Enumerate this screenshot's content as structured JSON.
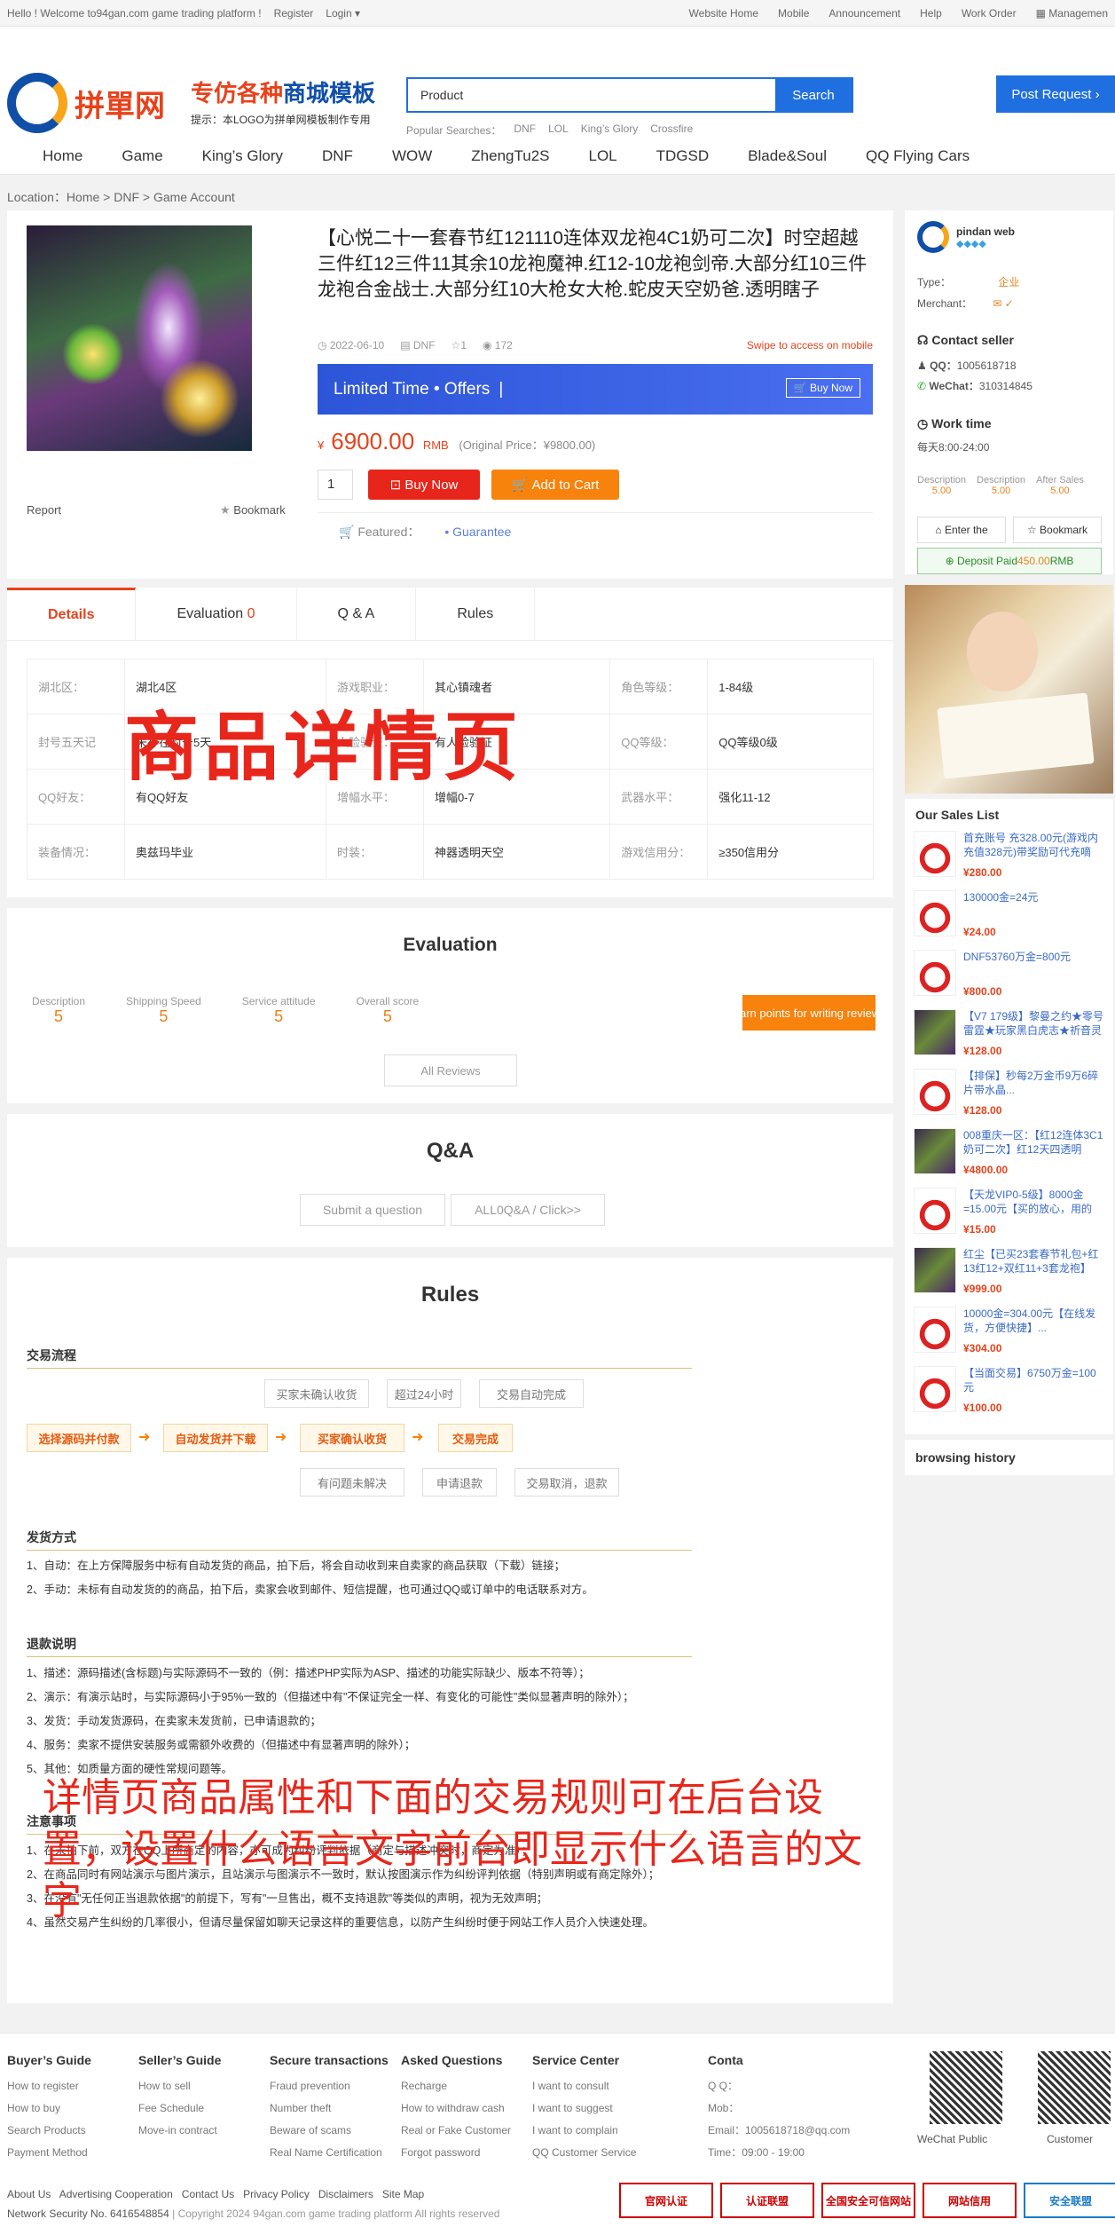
{
  "topbar": {
    "welcome": "Hello ! Welcome to94gan.com game trading platform !",
    "register": "Register",
    "login": "Login ▾",
    "links": [
      "Website Home",
      "Mobile",
      "Announcement",
      "Help",
      "Work Order"
    ],
    "management": "Managemen"
  },
  "header": {
    "logo_text": "拼單网",
    "slogan_line1_a": "专仿各种",
    "slogan_line1_b": "商城模板",
    "slogan_line2": "提示：本LOGO为拼单网模板制作专用",
    "search_value": "Product",
    "search_button": "Search",
    "popular_label": "Popular Searches：",
    "popular": [
      "DNF",
      "LOL",
      "King’s Glory",
      "Crossfire"
    ],
    "post_request": "Post Request ›"
  },
  "nav": [
    "Home",
    "Game",
    "King’s Glory",
    "DNF",
    "WOW",
    "ZhengTu2S",
    "LOL",
    "TDGSD",
    "Blade&Soul",
    "QQ Flying Cars"
  ],
  "breadcrumb": "Location：Home > DNF > Game Account",
  "product": {
    "title": "【心悦二十一套春节红121110连体双龙袍4C1奶可二次】时空超越三件红12三件11其余10龙袍魔神.红12-10龙袍剑帝.大部分红10三件龙袍合金战士.大部分红10大枪女大枪.蛇皮天空奶爸.透明瞎子",
    "date": "2022-06-10",
    "game": "DNF",
    "likes": "1",
    "views": "172",
    "swipe": "Swipe to access on mobile",
    "promo": "Limited Time • Offers",
    "promo_btn": "Buy Now",
    "currency": "¥",
    "price": "6900.00",
    "price_unit": "RMB",
    "original": "(Original Price：¥9800.00)",
    "qty": "1",
    "buy_now": "Buy Now",
    "add_cart": "Add to Cart",
    "featured": "Featured：",
    "guarantee": "• Guarantee",
    "report": "Report",
    "bookmark": "Bookmark"
  },
  "tabs": {
    "details": "Details",
    "evaluation": "Evaluation",
    "evaluation_count": "0",
    "qa": "Q & A",
    "rules": "Rules"
  },
  "attributes": [
    [
      "湖北区：",
      "湖北4区",
      "游戏职业：",
      "其心镇魂者",
      "角色等级：",
      "1-84级"
    ],
    [
      "封号五天记",
      "未存在封号5天",
      "人脸验证：",
      "有人脸验证",
      "QQ等级：",
      "QQ等级0级"
    ],
    [
      "QQ好友：",
      "有QQ好友",
      "增幅水平：",
      "增幅0-7",
      "武器水平：",
      "强化11-12"
    ],
    [
      "装备情况：",
      "奥兹玛毕业",
      "时装：",
      "神器透明天空",
      "游戏信用分：",
      "≥350信用分"
    ]
  ],
  "overlay1": "商品详情页",
  "evaluation": {
    "title": "Evaluation",
    "scores": [
      [
        "Description",
        "5"
      ],
      [
        "Shipping Speed",
        "5"
      ],
      [
        "Service attitude",
        "5"
      ],
      [
        "Overall score",
        "5"
      ]
    ],
    "earn": "Earn points for writing reviews",
    "all_reviews": "All Reviews"
  },
  "qa": {
    "title": "Q&A",
    "submit": "Submit a question",
    "all": "ALL0Q&A / Click>>"
  },
  "rules": {
    "title": "Rules",
    "flow_title": "交易流程",
    "flow_main": [
      "选择源码并付款",
      "自动发货并下载",
      "买家确认收货",
      "交易完成"
    ],
    "flow_top": [
      "买家未确认收货",
      "超过24小时",
      "交易自动完成"
    ],
    "flow_bottom": [
      "有问题未解决",
      "申请退款",
      "交易取消，退款"
    ],
    "ship_title": "发货方式",
    "ship": [
      "1、自动：在上方保障服务中标有自动发货的商品，拍下后，将会自动收到来自卖家的商品获取（下载）链接；",
      "2、手动：未标有自动发货的的商品，拍下后，卖家会收到邮件、短信提醒，也可通过QQ或订单中的电话联系对方。"
    ],
    "refund_title": "退款说明",
    "refund": [
      "1、描述：源码描述(含标题)与实际源码不一致的（例：描述PHP实际为ASP、描述的功能实际缺少、版本不符等）；",
      "2、演示：有演示站时，与实际源码小于95%一致的（但描述中有\"不保证完全一样、有变化的可能性\"类似显著声明的除外）；",
      "3、发货：手动发货源码，在卖家未发货前，已申请退款的；",
      "4、服务：卖家不提供安装服务或需额外收费的（但描述中有显著声明的除外）；",
      "5、其他：如质量方面的硬性常规问题等。"
    ],
    "note_title": "注意事项",
    "notes": [
      "1、在未拍下前，双方在QQ上所商定的内容，亦可成为纠纷评判依据（商定与描述冲突时，商定为准）；",
      "2、在商品同时有网站演示与图片演示，且站演示与图演示不一致时，默认按图演示作为纠纷评判依据（特别声明或有商定除外）；",
      "3、在没有\"无任何正当退款依据\"的前提下，写有\"一旦售出，概不支持退款\"等类似的声明，视为无效声明；",
      "4、虽然交易产生纠纷的几率很小，但请尽量保留如聊天记录这样的重要信息，以防产生纠纷时便于网站工作人员介入快速处理。"
    ]
  },
  "overlay2": "详情页商品属性和下面的交易规则可在后台设置，设置什么语言文字前台即显示什么语言的文字",
  "seller": {
    "name": "pindan web",
    "type_label": "Type：",
    "type_value": "企业",
    "merchant_label": "Merchant：",
    "contact_title": "Contact seller",
    "qq_label": "QQ：",
    "qq": "1005618718",
    "wechat_label": "WeChat：",
    "wechat": "310314845",
    "work_title": "Work time",
    "work_time": "每天8:00-24:00",
    "ratings": [
      [
        "Description",
        "5.00"
      ],
      [
        "Description",
        "5.00"
      ],
      [
        "After Sales",
        "5.00"
      ]
    ],
    "enter": "Enter the",
    "bookmark": "Bookmark",
    "deposit_label": "Deposit Paid",
    "deposit": "450.00",
    "deposit_unit": "RMB"
  },
  "sales": {
    "title": "Our Sales List",
    "items": [
      [
        "首充账号 充328.00元(游戏内充值328元)带奖励可代充嘀",
        "¥280.00"
      ],
      [
        "130000金=24元",
        "¥24.00"
      ],
      [
        "DNF53760万金=800元",
        "¥800.00"
      ],
      [
        "【V7 179级】黎曼之约★零号雷霆★玩家黑白虎志★祈音灵",
        "¥128.00"
      ],
      [
        "【排保】秒每2万金币9万6碎片带水晶...",
        "¥128.00"
      ],
      [
        "008重庆一区：【红12连体3C1奶可二次】红12天四透明",
        "¥4800.00"
      ],
      [
        "【天龙VIP0-5级】8000金=15.00元【买的放心，用的",
        "¥15.00"
      ],
      [
        "红尘【已买23套春节礼包+红13红12+双红11+3套龙袍】",
        "¥999.00"
      ],
      [
        "10000金=304.00元【在线发货，方便快捷】...",
        "¥304.00"
      ],
      [
        "【当面交易】6750万金=100元",
        "¥100.00"
      ]
    ],
    "history": "browsing history"
  },
  "footer": {
    "cols": [
      [
        "Buyer’s Guide",
        "How to register",
        "How to buy",
        "Search Products",
        "Payment Method"
      ],
      [
        "Seller’s Guide",
        "How to sell",
        "Fee Schedule",
        "Move-in contract"
      ],
      [
        "Secure transactions",
        "Fraud prevention",
        "Number theft",
        "Beware of scams",
        "Real Name Certification"
      ],
      [
        "Asked Questions",
        "Recharge",
        "How to withdraw cash",
        "Real or Fake Customer",
        "Forgot password"
      ],
      [
        "Service Center",
        "I want to consult",
        "I want to suggest",
        "I want to complain",
        "QQ Customer Service"
      ]
    ],
    "contact_title": "Conta",
    "contact_qq": "Q Q：",
    "contact_mob": "Mob：",
    "contact_email": "Email：1005618718@qq.com",
    "contact_time": "Time：09:00 - 19:00",
    "wechat_public": "WeChat Public",
    "customer": "Customer",
    "bottom_links": "About Us   Advertising Cooperation   Contact Us   Privacy Policy   Disclaimers   Site Map",
    "security": "Network Security No. 6416548854",
    "copyright": "| Copyright 2024 94gan.com game trading platform All rights reserved",
    "badges": [
      "官网认证",
      "认证联盟",
      "全国安全可信网站",
      "网站信用",
      "安全联盟"
    ]
  },
  "colors": {
    "brand_blue": "#1f6fe0",
    "accent_red": "#e8421b",
    "orange": "#f7820c"
  }
}
